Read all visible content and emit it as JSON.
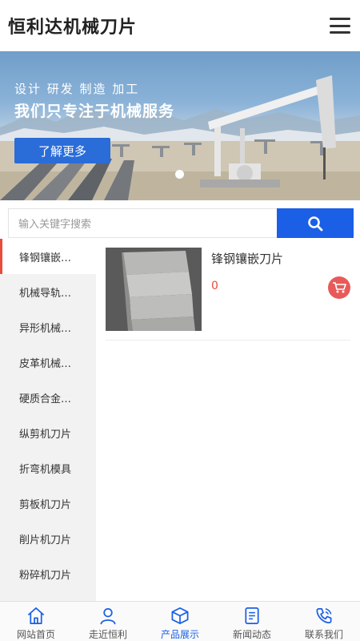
{
  "header": {
    "title": "恒利达机械刀片"
  },
  "banner": {
    "tagline": "设计 研发 制造 加工",
    "slogan": "我们只专注于机械服务",
    "button_label": "了解更多"
  },
  "search": {
    "placeholder": "输入关键字搜索"
  },
  "sidebar": {
    "items": [
      {
        "label": "锋钢镶嵌…"
      },
      {
        "label": "机械导轨…"
      },
      {
        "label": "异形机械…"
      },
      {
        "label": "皮革机械…"
      },
      {
        "label": "硬质合金…"
      },
      {
        "label": "纵剪机刀片"
      },
      {
        "label": "折弯机模具"
      },
      {
        "label": "剪板机刀片"
      },
      {
        "label": "削片机刀片"
      },
      {
        "label": "粉碎机刀片"
      }
    ]
  },
  "product": {
    "name": "锋钢镶嵌刀片",
    "price": "0"
  },
  "bottom_nav": {
    "tabs": [
      {
        "label": "网站首页",
        "icon": "home-icon"
      },
      {
        "label": "走近恒利",
        "icon": "user-icon"
      },
      {
        "label": "产品展示",
        "icon": "box-icon"
      },
      {
        "label": "新闻动态",
        "icon": "news-icon"
      },
      {
        "label": "联系我们",
        "icon": "phone-icon"
      }
    ]
  },
  "colors": {
    "accent": "#1a5fe6",
    "active_marker": "#e74c3c",
    "cart": "#e85a5a",
    "sidebar_bg": "#f2f2f2"
  }
}
